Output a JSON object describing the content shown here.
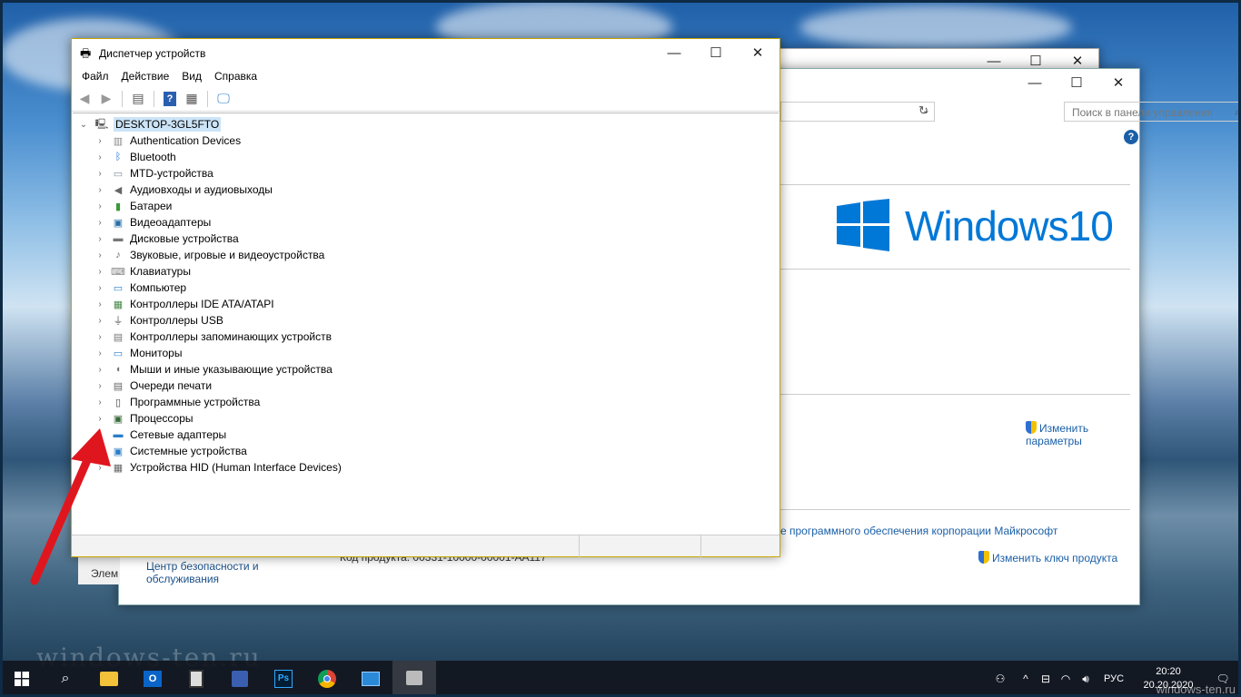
{
  "back_window": {
    "search_placeholder": "Поиск в панели управления",
    "windows_logo_text": "Windows",
    "windows_logo_version": "10",
    "change_params_label": "Изменить\nпараметры",
    "ms_license_text": "е программного обеспечения корпорации Майкрософт",
    "product_key_label": "Код продукта:",
    "product_key_value": "00331-10000-00001-AA117",
    "change_key_label": "Изменить ключ продукта",
    "security_center_label": "Центр безопасности и обслуживания",
    "elements_label": "Элем"
  },
  "device_manager": {
    "title": "Диспетчер устройств",
    "menu": [
      "Файл",
      "Действие",
      "Вид",
      "Справка"
    ],
    "root": "DESKTOP-3GL5FTO",
    "items": [
      {
        "label": "Authentication Devices",
        "icon": "fingerprint-icon",
        "color": "#888"
      },
      {
        "label": "Bluetooth",
        "icon": "bluetooth-icon",
        "color": "#1e6fd9"
      },
      {
        "label": "MTD-устройства",
        "icon": "memory-icon",
        "color": "#7a8a9a"
      },
      {
        "label": "Аудиовходы и аудиовыходы",
        "icon": "speaker-icon",
        "color": "#666"
      },
      {
        "label": "Батареи",
        "icon": "battery-icon",
        "color": "#3a9a3a"
      },
      {
        "label": "Видеоадаптеры",
        "icon": "display-adapter-icon",
        "color": "#2a6ea8"
      },
      {
        "label": "Дисковые устройства",
        "icon": "disk-icon",
        "color": "#777"
      },
      {
        "label": "Звуковые, игровые и видеоустройства",
        "icon": "sound-icon",
        "color": "#666"
      },
      {
        "label": "Клавиатуры",
        "icon": "keyboard-icon",
        "color": "#888"
      },
      {
        "label": "Компьютер",
        "icon": "computer-icon",
        "color": "#2a7ec8"
      },
      {
        "label": "Контроллеры IDE ATA/ATAPI",
        "icon": "ide-icon",
        "color": "#4a8a4a"
      },
      {
        "label": "Контроллеры USB",
        "icon": "usb-icon",
        "color": "#555"
      },
      {
        "label": "Контроллеры запоминающих устройств",
        "icon": "storage-controller-icon",
        "color": "#777"
      },
      {
        "label": "Мониторы",
        "icon": "monitor-icon",
        "color": "#2a7ec8"
      },
      {
        "label": "Мыши и иные указывающие устройства",
        "icon": "mouse-icon",
        "color": "#777"
      },
      {
        "label": "Очереди печати",
        "icon": "printer-icon",
        "color": "#666"
      },
      {
        "label": "Программные устройства",
        "icon": "software-device-icon",
        "color": "#444"
      },
      {
        "label": "Процессоры",
        "icon": "processor-icon",
        "color": "#3a6a3a"
      },
      {
        "label": "Сетевые адаптеры",
        "icon": "network-icon",
        "color": "#2a7ec8"
      },
      {
        "label": "Системные устройства",
        "icon": "system-device-icon",
        "color": "#2a7ec8"
      },
      {
        "label": "Устройства HID (Human Interface Devices)",
        "icon": "hid-icon",
        "color": "#666"
      }
    ]
  },
  "watermark": "windows-ten.ru",
  "watermark_bottom_right": "windows-ten.ru",
  "taskbar": {
    "lang": "РУС",
    "time": "20:20",
    "date": "20.20.2020"
  },
  "colors": {
    "accent": "#0078d7",
    "arrow": "#e0161e"
  }
}
